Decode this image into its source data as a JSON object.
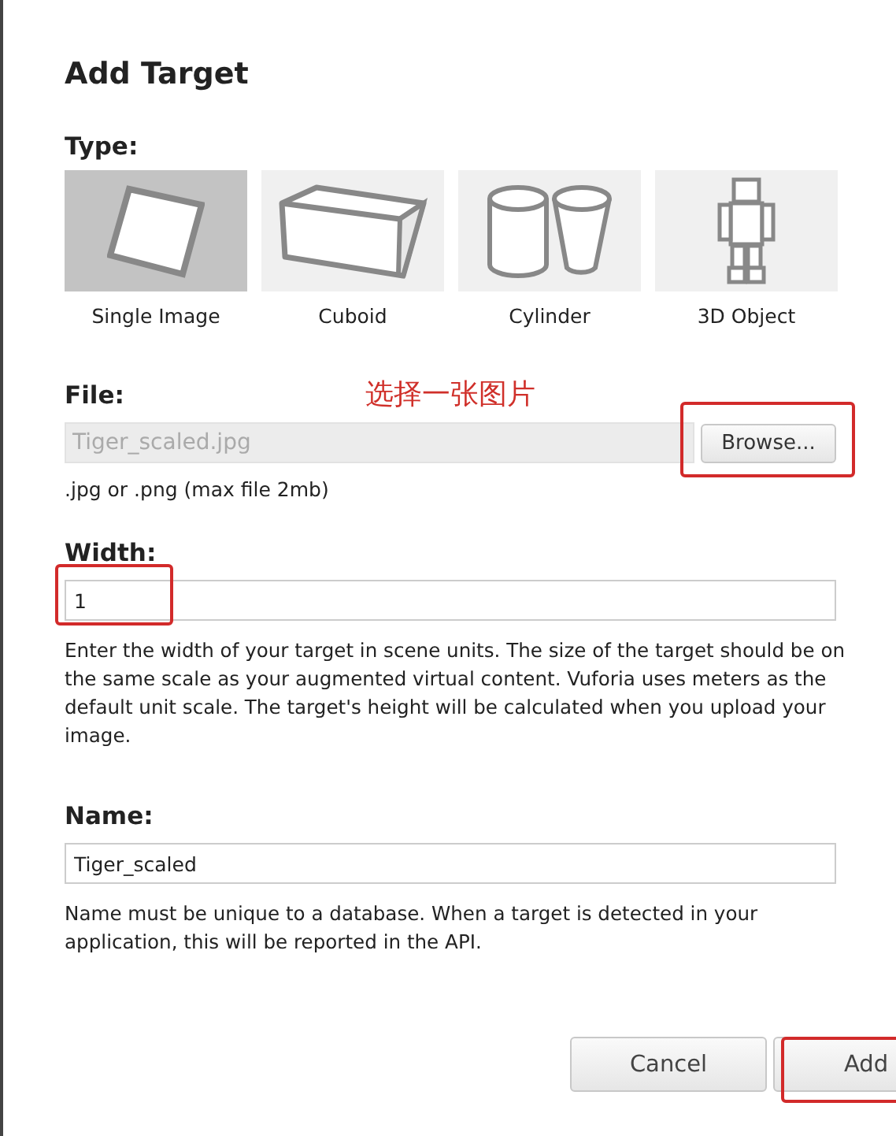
{
  "dialog": {
    "title": "Add Target"
  },
  "type": {
    "label": "Type:",
    "options": [
      {
        "kind": "image",
        "label": "Single Image",
        "selected": true
      },
      {
        "kind": "cuboid",
        "label": "Cuboid",
        "selected": false
      },
      {
        "kind": "cylinder",
        "label": "Cylinder",
        "selected": false
      },
      {
        "kind": "object",
        "label": "3D Object",
        "selected": false
      }
    ]
  },
  "file": {
    "label": "File:",
    "value": "Tiger_scaled.jpg",
    "button": "Browse...",
    "hint": ".jpg or .png (max file 2mb)",
    "annotation": "选择一张图片"
  },
  "width": {
    "label": "Width:",
    "value": "1",
    "help": "Enter the width of your target in scene units. The size of the target should be on the same scale as your augmented virtual content. Vuforia uses meters as the default unit scale. The target's height will be calculated when you upload your image."
  },
  "name": {
    "label": "Name:",
    "value": "Tiger_scaled",
    "help": "Name must be unique to a database. When a target is detected in your application, this will be reported in the API."
  },
  "buttons": [
    "Cancel",
    "Add"
  ]
}
